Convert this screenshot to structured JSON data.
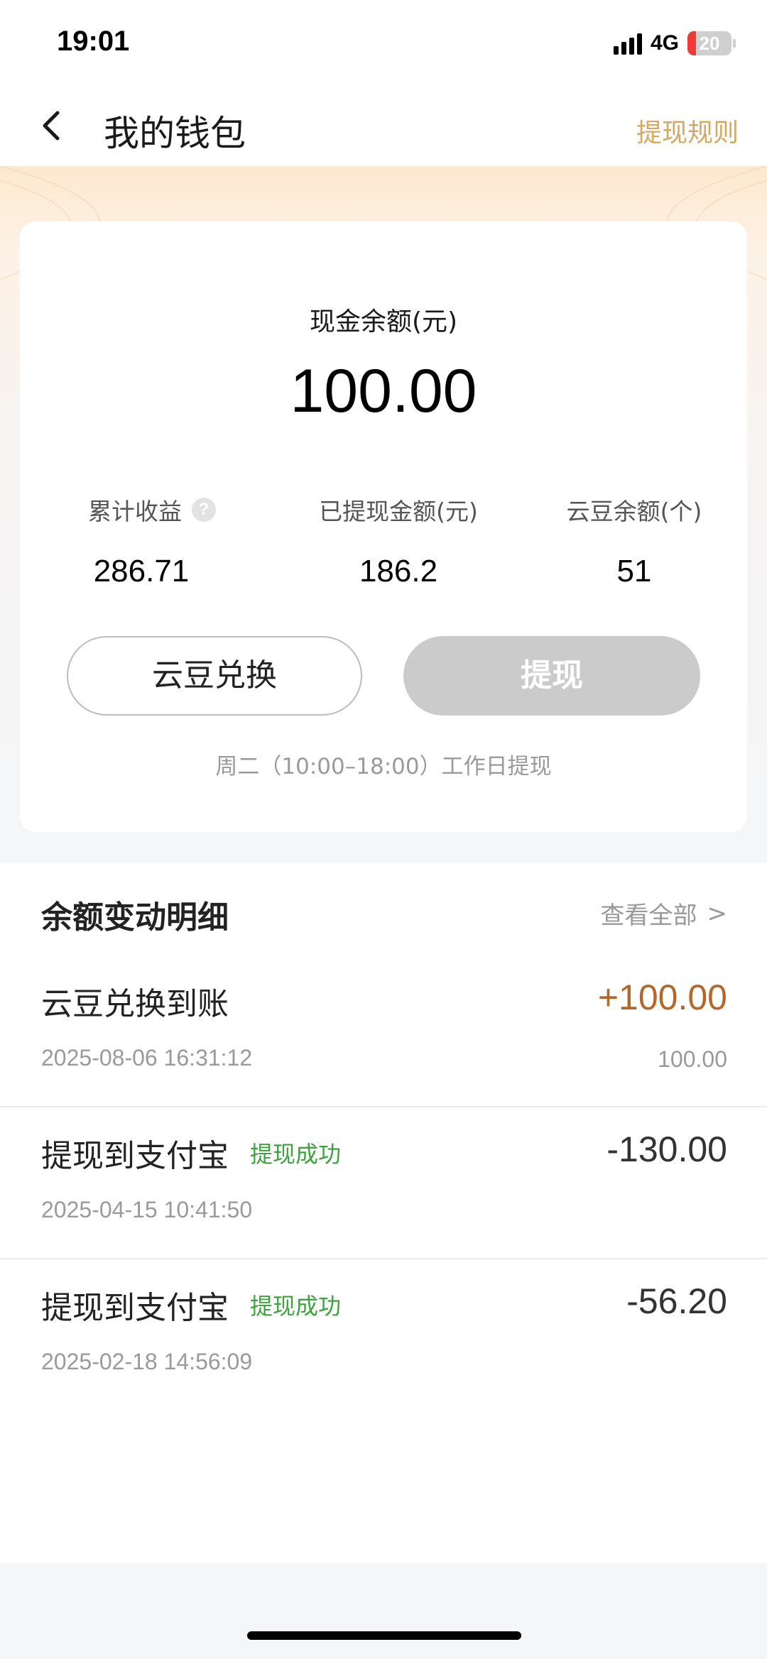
{
  "status_bar": {
    "time": "19:01",
    "network": "4G",
    "battery": "20",
    "battery_level_percent": 20,
    "signal_icon": "signal-bars-icon",
    "battery_icon": "battery-icon"
  },
  "nav": {
    "title": "我的钱包",
    "back_icon": "back-arrow-icon",
    "rule_link": "提现规则"
  },
  "balance": {
    "label": "现金余额(元)",
    "amount": "100.00",
    "stats": [
      {
        "label": "累计收益",
        "value": "286.71",
        "icon": "help-icon"
      },
      {
        "label": "已提现金额(元)",
        "value": "186.2"
      },
      {
        "label": "云豆余额(个)",
        "value": "51"
      }
    ],
    "help_glyph": "?",
    "exchange_button": "云豆兑换",
    "withdraw_button": "提现",
    "hint": "周二（10:00–18:00）工作日提现"
  },
  "details": {
    "title": "余额变动明细",
    "view_all": "查看全部",
    "view_all_chevron": ">",
    "transactions": [
      {
        "title": "云豆兑换到账",
        "status": "",
        "time": "2025-08-06 16:31:12",
        "amount": "+100.00",
        "sub": "100.00"
      },
      {
        "title": "提现到支付宝",
        "status": "提现成功",
        "time": "2025-04-15 10:41:50",
        "amount": "-130.00",
        "sub": ""
      },
      {
        "title": "提现到支付宝",
        "status": "提现成功",
        "time": "2025-02-18 14:56:09",
        "amount": "-56.20",
        "sub": ""
      }
    ]
  },
  "colors": {
    "accent_gold": "#d4a862",
    "positive_amount": "#b5672a",
    "success_green": "#3fa23f",
    "disabled_button": "#cbcbcb"
  }
}
